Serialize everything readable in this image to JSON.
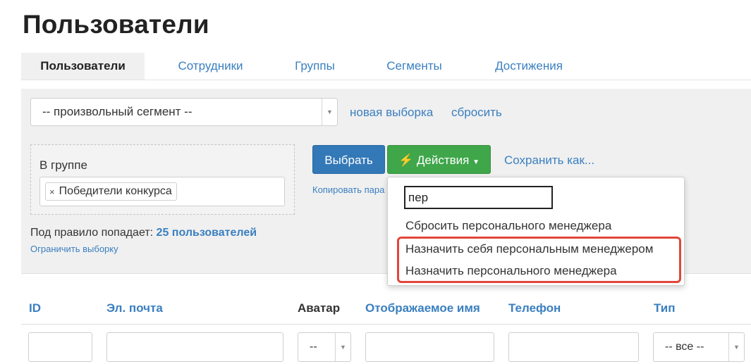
{
  "page": {
    "title": "Пользователи"
  },
  "tabs": [
    {
      "label": "Пользователи",
      "active": true
    },
    {
      "label": "Сотрудники"
    },
    {
      "label": "Группы"
    },
    {
      "label": "Сегменты"
    },
    {
      "label": "Достижения"
    }
  ],
  "segment": {
    "selected": "-- произвольный сегмент --",
    "new_selection": "новая выборка",
    "reset": "сбросить"
  },
  "filter": {
    "label": "В группе",
    "tags": [
      "Победители конкурса"
    ],
    "tag_remove_glyph": "×"
  },
  "rule": {
    "prefix": "Под правило попадает:",
    "count": "25 пользователей",
    "limit_link": "Ограничить выборку"
  },
  "actions": {
    "select_button": "Выбрать",
    "actions_button": "Действия",
    "actions_icon": "lightning-icon",
    "save_as": "Сохранить как...",
    "copy_link": "Копировать пара"
  },
  "dropdown": {
    "search_value": "пер",
    "items": [
      "Сбросить персонального менеджера",
      "Назначить себя персональным менеджером",
      "Назначить персонального менеджера"
    ],
    "highlight_color": "#e2463b"
  },
  "table": {
    "columns": [
      "ID",
      "Эл. почта",
      "Аватар",
      "Отображаемое имя",
      "Телефон",
      "Тип"
    ],
    "filters": {
      "avatar": "--",
      "type": "-- все --"
    }
  },
  "colors": {
    "link": "#3a7fc0",
    "primary_button": "#3378b7",
    "success_button": "#3fa64a"
  }
}
